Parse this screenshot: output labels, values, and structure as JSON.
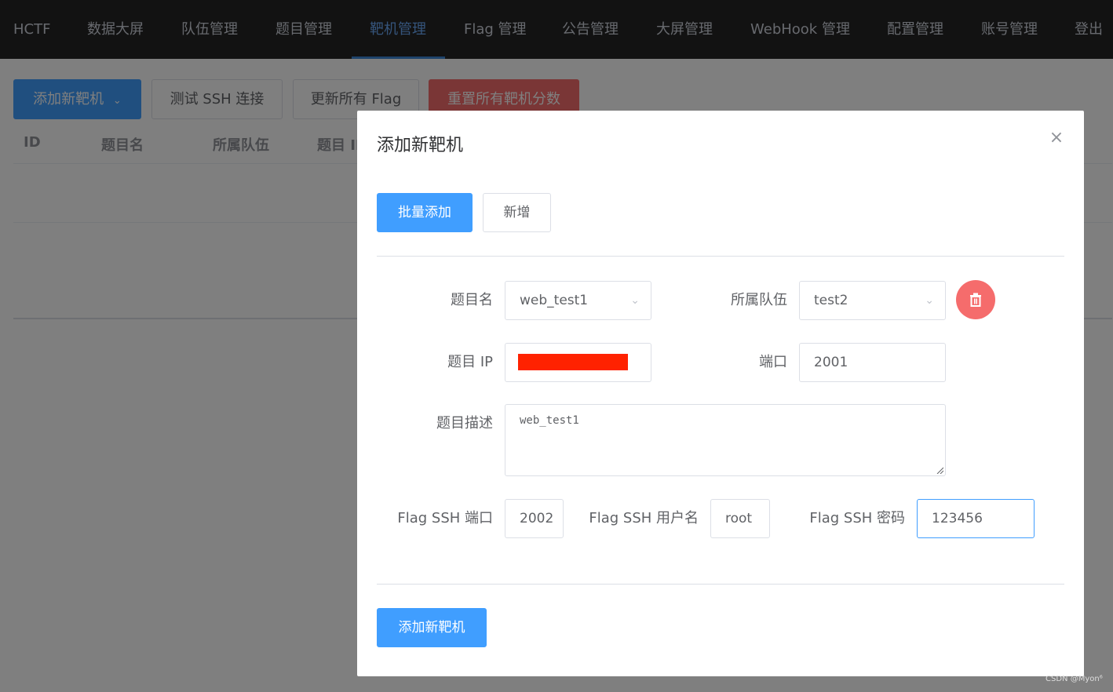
{
  "nav": {
    "brand": "HCTF",
    "items": [
      "数据大屏",
      "队伍管理",
      "题目管理",
      "靶机管理",
      "Flag 管理",
      "公告管理",
      "大屏管理",
      "WebHook 管理",
      "配置管理",
      "账号管理",
      "登出"
    ],
    "active": "靶机管理"
  },
  "toolbar": {
    "add_label": "添加新靶机",
    "test_ssh_label": "测试 SSH 连接",
    "update_flag_label": "更新所有 Flag",
    "reset_score_label": "重置所有靶机分数"
  },
  "table": {
    "headers": [
      "ID",
      "题目名",
      "所属队伍",
      "题目 ID"
    ]
  },
  "modal": {
    "title": "添加新靶机",
    "batch_label": "批量添加",
    "new_label": "新增",
    "form": {
      "challenge_label": "题目名",
      "challenge_value": "web_test1",
      "team_label": "所属队伍",
      "team_value": "test2",
      "ip_label": "题目 IP",
      "port_label": "端口",
      "port_value": "2001",
      "desc_label": "题目描述",
      "desc_value": "web_test1",
      "ssh_port_label": "Flag SSH 端口",
      "ssh_port_value": "2002",
      "ssh_user_label": "Flag SSH 用户名",
      "ssh_user_value": "root",
      "ssh_pass_label": "Flag SSH 密码",
      "ssh_pass_value": "123456"
    },
    "submit_label": "添加新靶机"
  },
  "watermark": "CSDN @Myon⁶",
  "colors": {
    "nav_bg": "#242424",
    "primary": "#409eff",
    "danger": "#f56c6c",
    "redaction": "#ff2200"
  }
}
